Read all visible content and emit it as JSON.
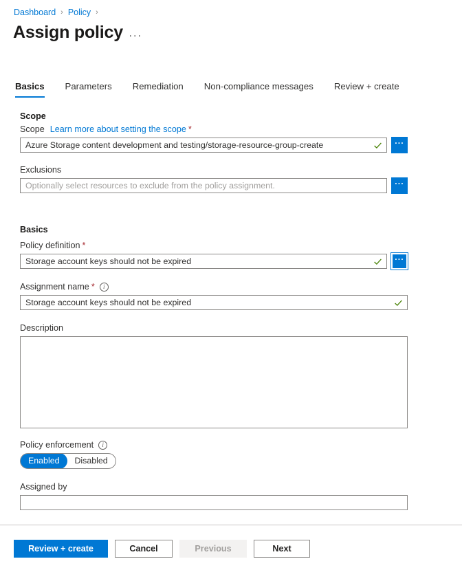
{
  "breadcrumb": {
    "items": [
      {
        "label": "Dashboard"
      },
      {
        "label": "Policy"
      }
    ],
    "separator": "›"
  },
  "header": {
    "title": "Assign policy",
    "overflow_label": "···"
  },
  "tabs": [
    {
      "label": "Basics",
      "active": true
    },
    {
      "label": "Parameters",
      "active": false
    },
    {
      "label": "Remediation",
      "active": false
    },
    {
      "label": "Non-compliance messages",
      "active": false
    },
    {
      "label": "Review + create",
      "active": false
    }
  ],
  "scope_section": {
    "heading": "Scope",
    "scope_field": {
      "label": "Scope",
      "link_text": "Learn more about setting the scope",
      "required_marker": "*",
      "value": "Azure Storage content development and testing/storage-resource-group-create",
      "placeholder": "",
      "valid": true,
      "picker_label": "···"
    },
    "exclusions_field": {
      "label": "Exclusions",
      "value": "",
      "placeholder": "Optionally select resources to exclude from the policy assignment.",
      "picker_label": "···"
    }
  },
  "basics_section": {
    "heading": "Basics",
    "policy_definition": {
      "label": "Policy definition",
      "required_marker": "*",
      "value": "Storage account keys should not be expired",
      "valid": true,
      "picker_label": "···"
    },
    "assignment_name": {
      "label": "Assignment name",
      "required_marker": "*",
      "info_glyph": "i",
      "value": "Storage account keys should not be expired",
      "valid": true
    },
    "description": {
      "label": "Description",
      "value": "",
      "placeholder": ""
    },
    "policy_enforcement": {
      "label": "Policy enforcement",
      "info_glyph": "i",
      "options": [
        "Enabled",
        "Disabled"
      ],
      "selected": "Enabled"
    },
    "assigned_by": {
      "label": "Assigned by",
      "value": "",
      "placeholder": ""
    }
  },
  "footer": {
    "review_create": "Review + create",
    "cancel": "Cancel",
    "previous": "Previous",
    "next": "Next"
  },
  "colors": {
    "accent": "#0078d4",
    "link": "#0078d4",
    "required": "#a4262c",
    "valid_check": "#498205",
    "border": "#8a8886",
    "disabled_bg": "#f3f2f1",
    "disabled_text": "#a19f9d"
  }
}
